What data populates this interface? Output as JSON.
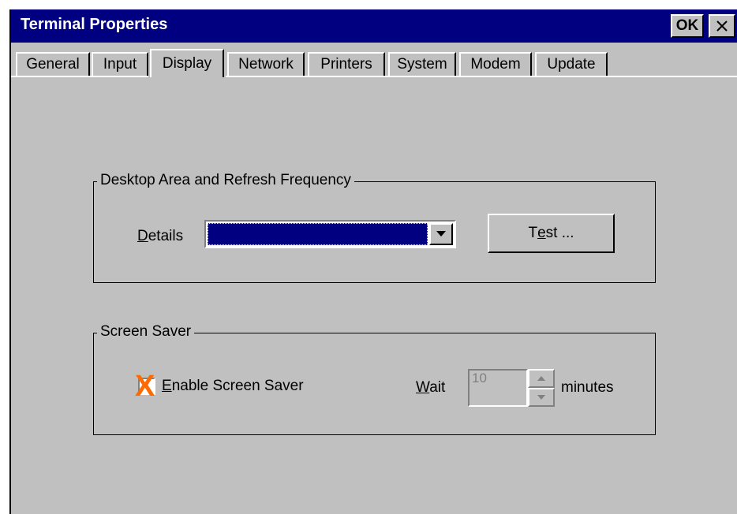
{
  "window": {
    "title": "Terminal Properties",
    "ok_label": "OK",
    "close_glyph": "close-icon"
  },
  "tabs": [
    {
      "label": "General",
      "active": false
    },
    {
      "label": "Input",
      "active": false
    },
    {
      "label": "Display",
      "active": true
    },
    {
      "label": "Network",
      "active": false
    },
    {
      "label": "Printers",
      "active": false
    },
    {
      "label": "System",
      "active": false
    },
    {
      "label": "Modem",
      "active": false
    },
    {
      "label": "Update",
      "active": false
    }
  ],
  "desktop_group": {
    "label": "Desktop Area and Refresh Frequency",
    "details_label_accel": "D",
    "details_label_rest": "etails",
    "details_value": "",
    "test_button_pre": "T",
    "test_button_accel": "e",
    "test_button_post": "st ..."
  },
  "screensaver_group": {
    "label": "Screen Saver",
    "enable_accel_pre": "",
    "enable_accel": "E",
    "enable_rest": "nable Screen Saver",
    "enable_checked": false,
    "wait_accel": "W",
    "wait_rest": "ait",
    "wait_value": "10",
    "minutes_label": "minutes"
  },
  "annotation": {
    "mark": "X",
    "color": "#ff6a00"
  },
  "colors": {
    "titlebar": "#000080",
    "face": "#c0c0c0",
    "selection": "#000080"
  }
}
